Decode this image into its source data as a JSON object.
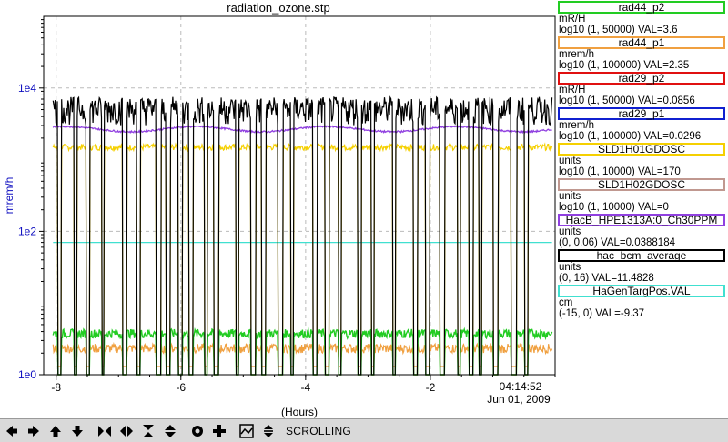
{
  "title": "radiation_ozone.stp",
  "chart_data": {
    "type": "line",
    "ylabel": "mrem/h",
    "xlabel": "(Hours)",
    "y_scale": "log",
    "ylim": [
      1,
      100000
    ],
    "y_ticks": [
      {
        "value": 1,
        "label": "1e0"
      },
      {
        "value": 100,
        "label": "1e2"
      },
      {
        "value": 10000,
        "label": "1e4"
      }
    ],
    "xlim": [
      -8.2,
      0
    ],
    "x_ticks": [
      {
        "value": -8,
        "label": "-8"
      },
      {
        "value": -6,
        "label": "-6"
      },
      {
        "value": -4,
        "label": "-4"
      },
      {
        "value": -2,
        "label": "-2"
      }
    ],
    "end_time": "04:14:52",
    "end_date": "Jun 01, 2009",
    "grid": true,
    "legend_position": "right",
    "series": [
      {
        "name": "rad44_p2",
        "color": "#22cc22",
        "units": "mR/H",
        "range": "log10 (1, 50000)",
        "value": "VAL=3.6",
        "level": 3.6
      },
      {
        "name": "rad44_p1",
        "color": "#f0a040",
        "units": "mrem/h",
        "range": "log10 (1, 100000)",
        "value": "VAL=2.35",
        "level": 2.35
      },
      {
        "name": "rad29_p2",
        "color": "#e01010",
        "units": "mR/H",
        "range": "log10 (1, 50000)",
        "value": "VAL=0.0856",
        "level": 0.0856
      },
      {
        "name": "rad29_p1",
        "color": "#1020d0",
        "units": "mrem/h",
        "range": "log10 (1, 100000)",
        "value": "VAL=0.0296",
        "level": 0.0296
      },
      {
        "name": "SLD1H01GDOSC",
        "color": "#f5d000",
        "units": "units",
        "range": "log10 (1, 10000)",
        "value": "VAL=170",
        "level": 1500
      },
      {
        "name": "SLD1H02GDOSC",
        "color": "#c09890",
        "units": "units",
        "range": "log10 (1, 10000)",
        "value": "VAL=0",
        "level": 1
      },
      {
        "name": "HacB_HPE1313A:0_Ch30PPM",
        "color": "#9040e0",
        "units": "units",
        "range": "(0, 0.06)",
        "value": "VAL=0.0388184",
        "level": 2800
      },
      {
        "name": "hac_bcm_average",
        "color": "#000000",
        "units": "units",
        "range": "(0, 16)",
        "value": "VAL=11.4828",
        "level": 5000
      },
      {
        "name": "HaGenTargPos.VAL",
        "color": "#40e0d0",
        "units": "cm",
        "range": "(-15, 0)",
        "value": "VAL=-9.37",
        "level": 70
      }
    ]
  },
  "toolbar": {
    "status": "SCROLLING",
    "buttons": [
      "arrow-left-icon",
      "arrow-right-icon",
      "arrow-up-icon",
      "arrow-down-icon",
      "zoom-in-horizontal-icon",
      "zoom-out-horizontal-icon",
      "zoom-in-vertical-icon",
      "zoom-out-vertical-icon",
      "record-icon",
      "crosshair-icon",
      "autoscale-icon",
      "stretch-icon"
    ]
  }
}
